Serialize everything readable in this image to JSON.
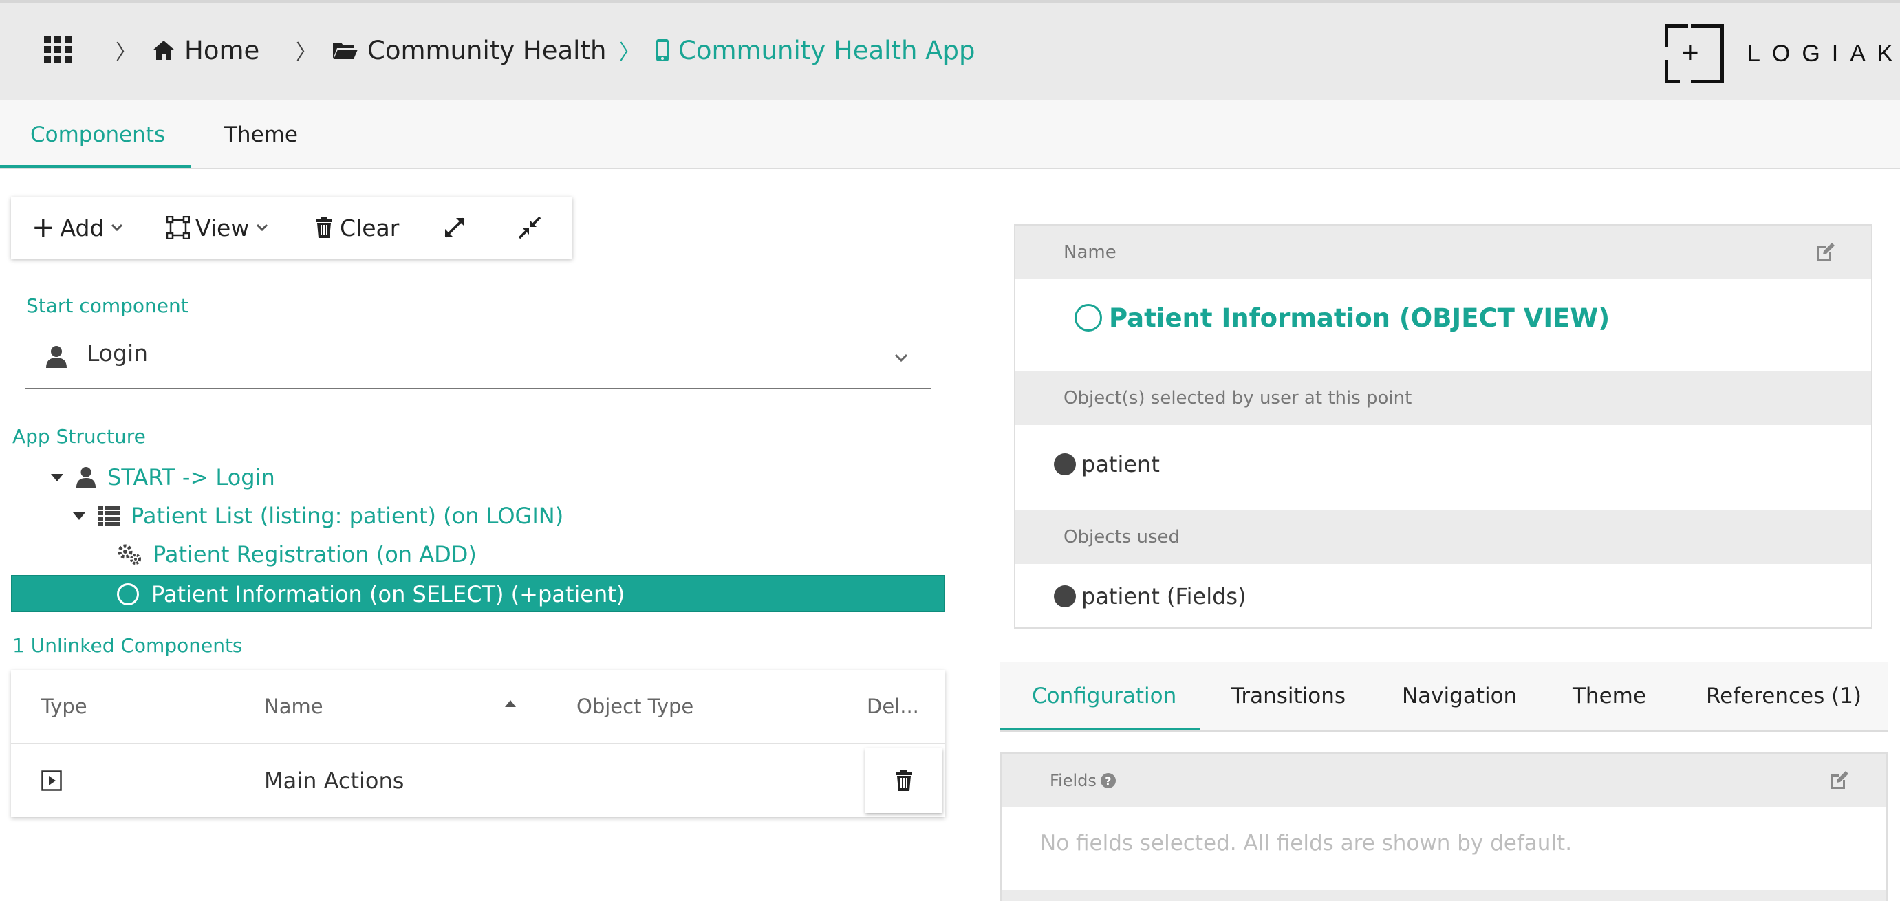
{
  "breadcrumb": {
    "home": "Home",
    "group": "Community Health",
    "app": "Community Health App"
  },
  "logo": {
    "text": "LOGIAK"
  },
  "tabs": [
    {
      "label": "Components",
      "active": true
    },
    {
      "label": "Theme",
      "active": false
    }
  ],
  "toolbar": {
    "add": "Add",
    "view": "View",
    "clear": "Clear"
  },
  "start_component": {
    "label": "Start component",
    "value": "Login"
  },
  "app_structure": {
    "label": "App Structure",
    "items": [
      {
        "label": "START -> Login",
        "icon": "user-icon"
      },
      {
        "label": "Patient List (listing: patient) (on LOGIN)",
        "icon": "list-icon"
      },
      {
        "label": "Patient Registration (on ADD)",
        "icon": "gears-icon"
      },
      {
        "label": "Patient Information (on SELECT) (+patient)",
        "icon": "circle-icon",
        "selected": true
      }
    ]
  },
  "unlinked": {
    "label": "1 Unlinked Components",
    "columns": [
      "Type",
      "Name",
      "Object Type",
      "Del..."
    ],
    "rows": [
      {
        "type_icon": "play-square-icon",
        "name": "Main Actions",
        "object_type": ""
      }
    ]
  },
  "detail": {
    "name_label": "Name",
    "name_value": "Patient Information (OBJECT VIEW)",
    "selected_label": "Object(s) selected by user at this point",
    "selected_value": "patient",
    "used_label": "Objects used",
    "used_value": "patient (Fields)"
  },
  "detail_tabs": [
    {
      "label": "Configuration",
      "active": true
    },
    {
      "label": "Transitions",
      "active": false
    },
    {
      "label": "Navigation",
      "active": false
    },
    {
      "label": "Theme",
      "active": false
    },
    {
      "label": "References (1)",
      "active": false
    }
  ],
  "fields": {
    "label": "Fields",
    "empty_text": "No fields selected. All fields are shown by default."
  },
  "colors": {
    "accent": "#19a594",
    "header_bg": "#eaeaea"
  }
}
